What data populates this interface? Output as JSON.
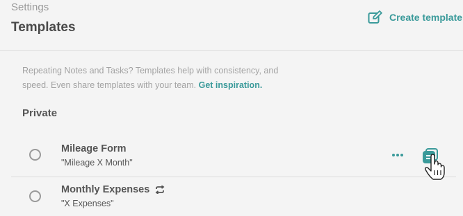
{
  "header": {
    "breadcrumb": "Settings",
    "title": "Templates",
    "create_label": "Create template"
  },
  "intro": {
    "text": "Repeating Notes and Tasks? Templates help with consistency, and speed. Even share templates with your team.",
    "link_label": "Get inspiration."
  },
  "section": {
    "label": "Private"
  },
  "templates": [
    {
      "title": "Mileage Form",
      "subtitle": "\"Mileage X Month\"",
      "repeating": false
    },
    {
      "title": "Monthly Expenses",
      "subtitle": "\"X Expenses\"",
      "repeating": true
    }
  ],
  "colors": {
    "accent": "#3a9a9a",
    "muted": "#a3a3a3",
    "text": "#4a4a4a",
    "background": "#f4f4f4"
  },
  "icons": {
    "create": "edit-square-icon",
    "repeat": "repeat-icon",
    "more": "more-horizontal-icon",
    "use": "stacked-notes-icon",
    "cursor": "hand-pointer-icon"
  }
}
